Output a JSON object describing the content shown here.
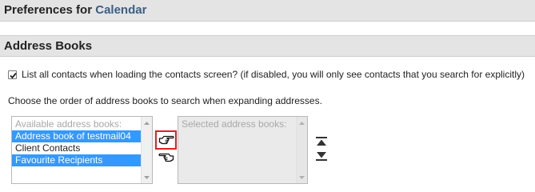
{
  "header": {
    "title_prefix": "Preferences for ",
    "app_name": "Calendar"
  },
  "section": {
    "title": "Address Books"
  },
  "list_all_contacts": {
    "checked": true,
    "label": "List all contacts when loading the contacts screen? (if disabled, you will only see contacts that you search for explicitly)"
  },
  "order_instructions": "Choose the order of address books to search when expanding addresses.",
  "available_list": {
    "heading": "Available address books:",
    "items": [
      {
        "label": "Address book of testmail04",
        "selected": true
      },
      {
        "label": "Client Contacts",
        "selected": false
      },
      {
        "label": "Favourite Recipients",
        "selected": true
      }
    ]
  },
  "selected_list": {
    "heading": "Selected address books:"
  },
  "icons": {
    "add": "hand-pointing-right-icon",
    "remove": "hand-pointing-left-icon",
    "move_top": "move-to-top-icon",
    "move_bottom": "move-to-bottom-icon",
    "highlight_color": "#e02020",
    "selection_color": "#3399ff",
    "link_color": "#3b5f83"
  }
}
